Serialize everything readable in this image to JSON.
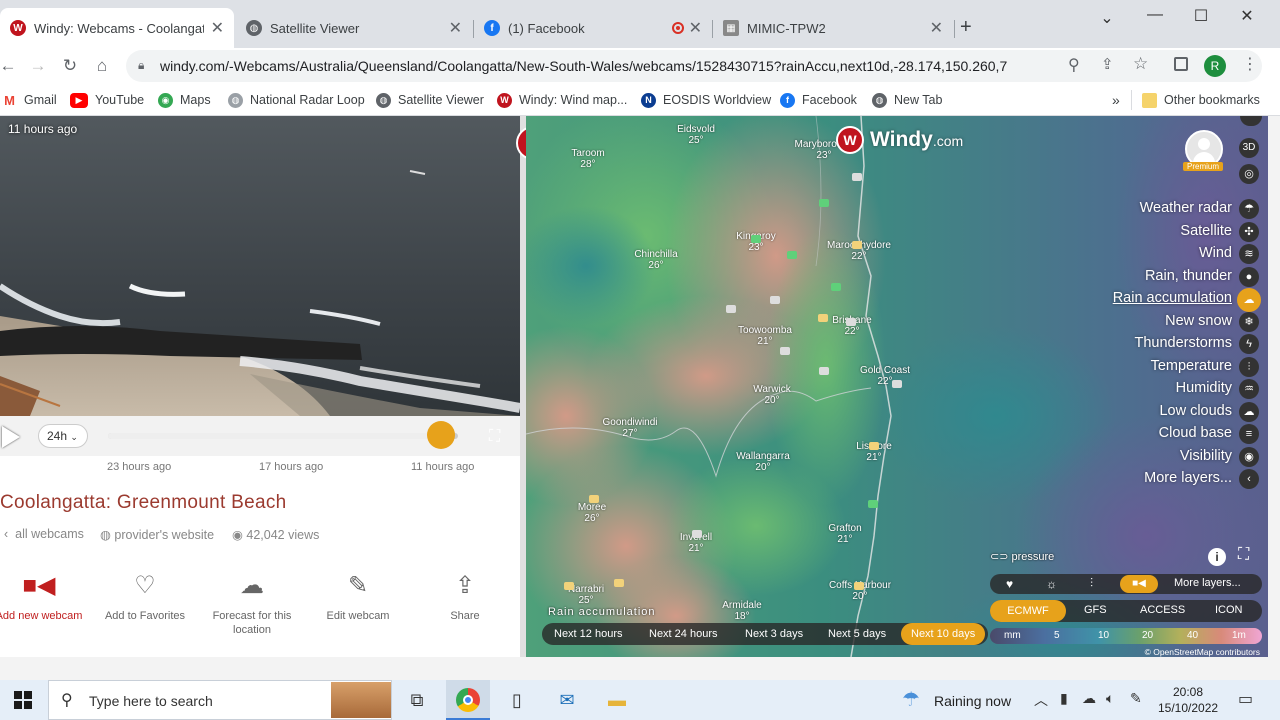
{
  "tabs": [
    {
      "title": "Windy: Webcams - Coolangatta: Greenmount Beach",
      "close": "✕",
      "active": true,
      "icon": "windy-icon"
    },
    {
      "title": "Satellite Viewer",
      "close": "✕",
      "active": false,
      "icon": "globe-icon"
    },
    {
      "title": "(1) Facebook",
      "close": "✕",
      "active": false,
      "icon": "facebook-icon"
    },
    {
      "title": "MIMIC-TPW2",
      "close": "✕",
      "active": false,
      "icon": "page-icon"
    }
  ],
  "new_tab": "+",
  "window_controls": {
    "down": "⌄",
    "minimize": "—",
    "maximize": "☐",
    "close": "✕"
  },
  "address": {
    "url": "windy.com/-Webcams/Australia/Queensland/Coolangatta/New-South-Wales/webcams/1528430715?rainAccu,next10d,-28.174,150.260,7",
    "profile_initial": "R"
  },
  "bookmarks": [
    "Gmail",
    "YouTube",
    "Maps",
    "National Radar Loop",
    "Satellite Viewer",
    "Windy: Wind map...",
    "EOSDIS Worldview",
    "Facebook",
    "New Tab"
  ],
  "bookmarks_more": "»",
  "other_bookmarks": "Other bookmarks",
  "webcam": {
    "timestamp": "11 hours ago",
    "duration_select": "24h",
    "time_labels": [
      "23 hours ago",
      "17 hours ago",
      "11 hours ago"
    ],
    "title": "Coolangatta: Greenmount Beach",
    "all_webcams": "all webcams",
    "provider": "provider's website",
    "views": "42,042 views",
    "actions": [
      {
        "label": "Add new webcam",
        "icon": "video-camera-icon"
      },
      {
        "label": "Add to Favorites",
        "icon": "heart-icon"
      },
      {
        "label": "Forecast for this location",
        "icon": "weather-forecast-icon"
      },
      {
        "label": "Edit webcam",
        "icon": "pencil-icon"
      },
      {
        "label": "Share",
        "icon": "share-icon"
      }
    ],
    "slider_position": 0.95
  },
  "map": {
    "logo": "Windy",
    "logo_suffix": ".com",
    "premium": "Premium",
    "btn_3d": "3D",
    "cities": [
      {
        "name": "Eidsvold",
        "temp": "25°"
      },
      {
        "name": "Taroom",
        "temp": "28°"
      },
      {
        "name": "Maryborough",
        "temp": "23°"
      },
      {
        "name": "Kingaroy",
        "temp": "23°"
      },
      {
        "name": "Maroochydore",
        "temp": "22°"
      },
      {
        "name": "Chinchilla",
        "temp": "26°"
      },
      {
        "name": "Brisbane",
        "temp": "22°"
      },
      {
        "name": "Toowoomba",
        "temp": "21°"
      },
      {
        "name": "Gold Coast",
        "temp": "22°"
      },
      {
        "name": "Warwick",
        "temp": "20°"
      },
      {
        "name": "Goondiwindi",
        "temp": "27°"
      },
      {
        "name": "Wallangarra",
        "temp": "20°"
      },
      {
        "name": "Lismore",
        "temp": "21°"
      },
      {
        "name": "Moree",
        "temp": "26°"
      },
      {
        "name": "Grafton",
        "temp": "21°"
      },
      {
        "name": "Inverell",
        "temp": "21°"
      },
      {
        "name": "Narrabri",
        "temp": "25°"
      },
      {
        "name": "Coffs Harbour",
        "temp": "20°"
      },
      {
        "name": "Armidale",
        "temp": "18°"
      }
    ],
    "layers": [
      "Weather radar",
      "Satellite",
      "Wind",
      "Rain, thunder",
      "Rain accumulation",
      "New snow",
      "Thunderstorms",
      "Temperature",
      "Humidity",
      "Low clouds",
      "Cloud base",
      "Visibility",
      "More layers..."
    ],
    "active_layer": "Rain accumulation",
    "pressure_label": "pressure",
    "more_layers_btn": "More layers...",
    "models": [
      "ECMWF",
      "GFS",
      "ACCESS",
      "ICON"
    ],
    "active_model": "ECMWF",
    "layer_caption": "Rain accumulation",
    "time_ranges": [
      "Next 12 hours",
      "Next 24 hours",
      "Next 3 days",
      "Next 5 days",
      "Next 10 days"
    ],
    "active_time_range": "Next 10 days",
    "scale": [
      "mm",
      "5",
      "10",
      "20",
      "40",
      "1m"
    ],
    "attribution": "© OpenStreetMap contributors"
  },
  "taskbar": {
    "search_placeholder": "Type here to search",
    "weather": "Raining now",
    "time": "20:08",
    "date": "15/10/2022"
  }
}
